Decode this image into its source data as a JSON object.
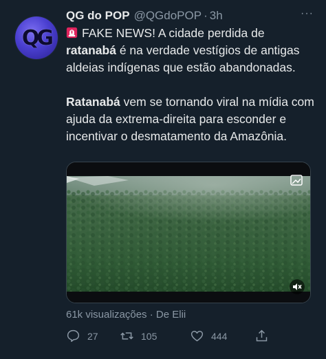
{
  "account": {
    "avatar_text": "QG",
    "name": "QG do POP",
    "handle": "@QGdoPOP",
    "separator": "·",
    "time": "3h",
    "more_label": "···"
  },
  "tweet": {
    "para1_emoji": "siren-icon",
    "para1_text1": "FAKE NEWS! A cidade perdida de",
    "para1_bold": "ratanabá",
    "para1_text2": " é na verdade vestígios de antigas aldeias indígenas que estão abandonadas.",
    "para2_bold": "Ratanabá",
    "para2_text": " vem se tornando viral na mídia com ajuda da extrema-direita para esconder e incentivar o desmatamento da Amazônia."
  },
  "media": {
    "type": "video",
    "content": "aerial-forest-video",
    "watermark_icon": "video-embed-icon",
    "mute_icon": "speaker-muted-icon"
  },
  "meta": {
    "views": "61k visualizações",
    "separator": " · ",
    "source": "De Elii"
  },
  "actions": {
    "reply_count": "27",
    "retweet_count": "105",
    "like_count": "444"
  },
  "colors": {
    "background": "#15202b",
    "text": "#e7e9ea",
    "secondary": "#8b98a5",
    "siren": "#e0245e"
  }
}
